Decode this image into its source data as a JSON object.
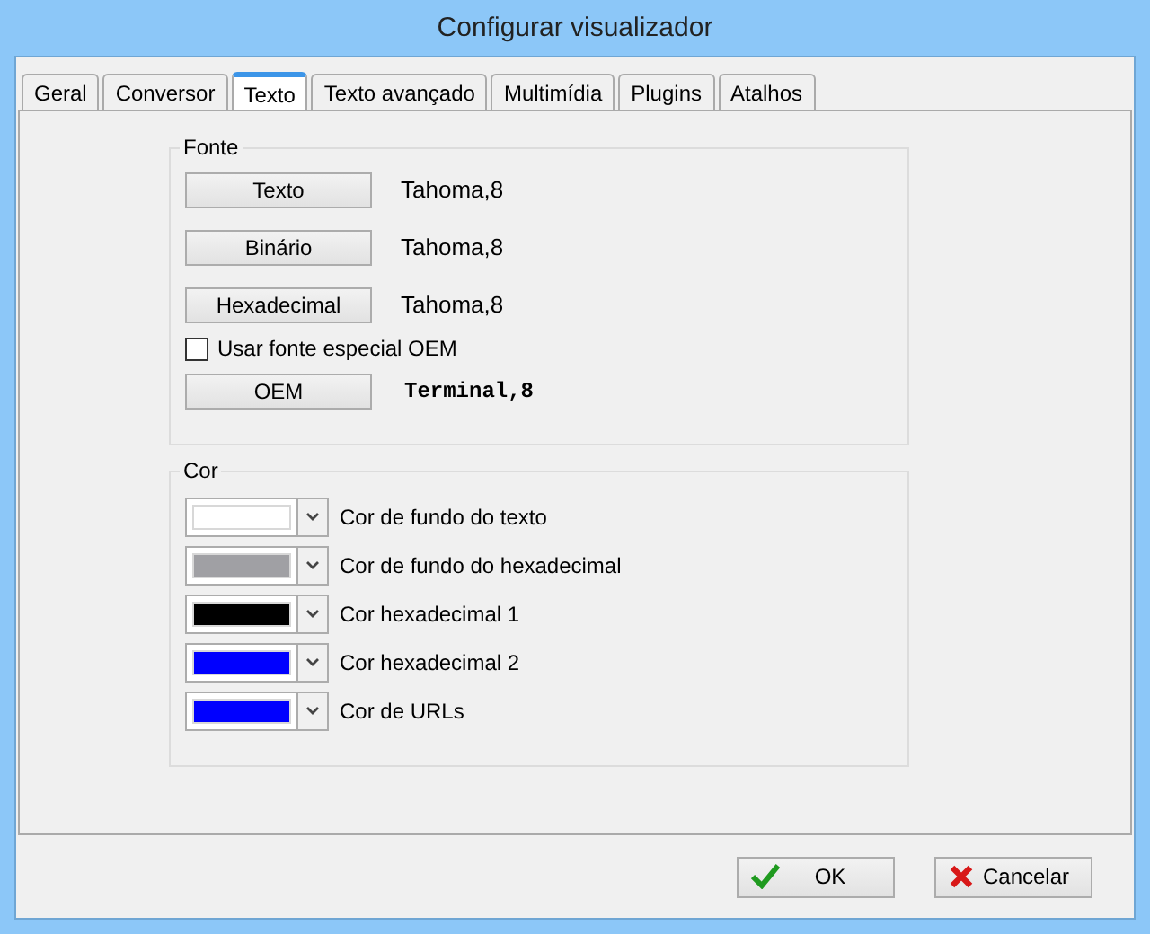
{
  "window": {
    "title": "Configurar visualizador"
  },
  "tabs": [
    {
      "label": "Geral",
      "selected": false
    },
    {
      "label": "Conversor",
      "selected": false
    },
    {
      "label": "Texto",
      "selected": true
    },
    {
      "label": "Texto avançado",
      "selected": false
    },
    {
      "label": "Multimídia",
      "selected": false
    },
    {
      "label": "Plugins",
      "selected": false
    },
    {
      "label": "Atalhos",
      "selected": false
    }
  ],
  "font_group": {
    "title": "Fonte",
    "items": [
      {
        "kind": "font",
        "button": "Texto",
        "value": "Tahoma,8"
      },
      {
        "kind": "font",
        "button": "Binário",
        "value": "Tahoma,8"
      },
      {
        "kind": "font",
        "button": "Hexadecimal",
        "value": "Tahoma,8"
      },
      {
        "kind": "checkbox",
        "label": "Usar fonte especial OEM",
        "checked": false
      },
      {
        "kind": "terminal_font",
        "button": "OEM",
        "value": "Terminal,8"
      }
    ]
  },
  "color_group": {
    "title": "Cor",
    "items": [
      {
        "label": "Cor de fundo do texto",
        "color": "#ffffff"
      },
      {
        "label": "Cor de fundo do hexadecimal",
        "color": "#a0a0a4"
      },
      {
        "label": "Cor hexadecimal 1",
        "color": "#000000"
      },
      {
        "label": "Cor hexadecimal 2",
        "color": "#0000ff"
      },
      {
        "label": "Cor de URLs",
        "color": "#0000ff"
      }
    ]
  },
  "buttons": [
    {
      "kind": "ok",
      "label": "OK"
    },
    {
      "kind": "cancel",
      "label": "Cancelar"
    }
  ]
}
